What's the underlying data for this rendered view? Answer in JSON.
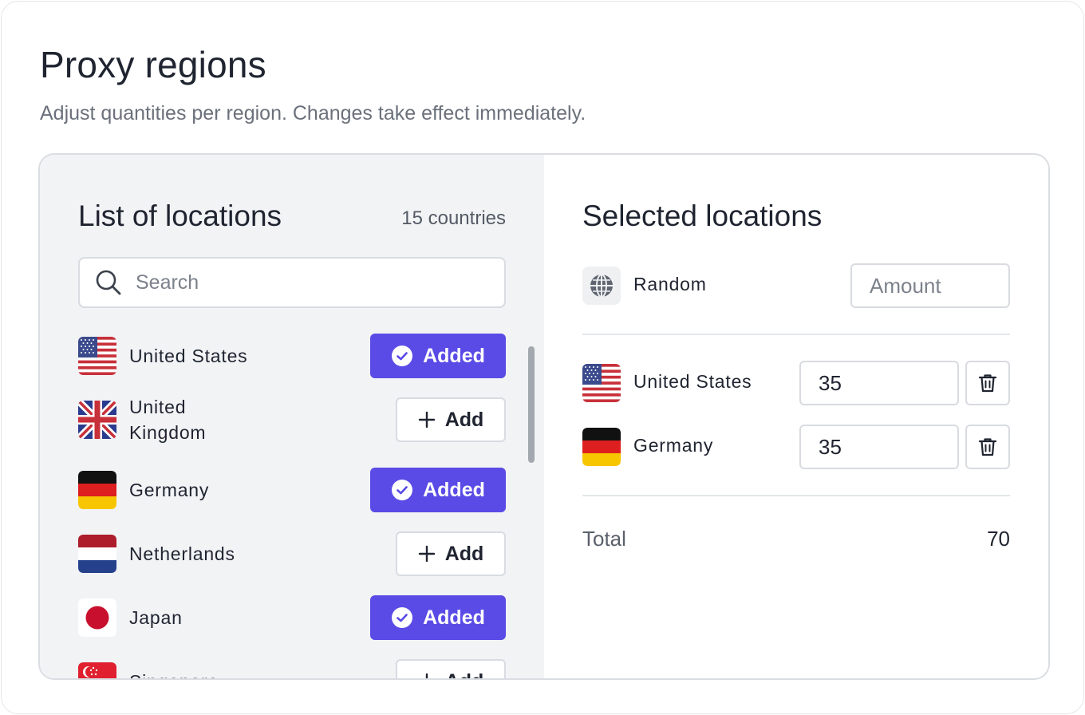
{
  "page": {
    "title": "Proxy regions",
    "subtitle": "Adjust quantities per region. Changes take effect immediately."
  },
  "locations": {
    "title": "List of locations",
    "count": "15 countries",
    "search_placeholder": "Search",
    "added_label": "Added",
    "add_label": "Add",
    "items": [
      {
        "name": "United States",
        "flag": "us-flag-icon",
        "status": "added"
      },
      {
        "name": "United Kingdom",
        "flag": "uk-flag-icon",
        "status": "add"
      },
      {
        "name": "Germany",
        "flag": "de-flag-icon",
        "status": "added"
      },
      {
        "name": "Netherlands",
        "flag": "nl-flag-icon",
        "status": "add"
      },
      {
        "name": "Japan",
        "flag": "jp-flag-icon",
        "status": "added"
      },
      {
        "name": "Singapore",
        "flag": "sg-flag-icon",
        "status": "add"
      }
    ]
  },
  "selected": {
    "title": "Selected locations",
    "random_label": "Random",
    "amount_placeholder": "Amount",
    "items": [
      {
        "name": "United States",
        "flag": "us-flag-icon",
        "quantity": "35"
      },
      {
        "name": "Germany",
        "flag": "de-flag-icon",
        "quantity": "35"
      }
    ],
    "total_label": "Total",
    "total_value": "70"
  },
  "colors": {
    "accent": "#5a4be6",
    "left_panel_bg": "#f1f3f5",
    "border": "#d8dbe0"
  }
}
